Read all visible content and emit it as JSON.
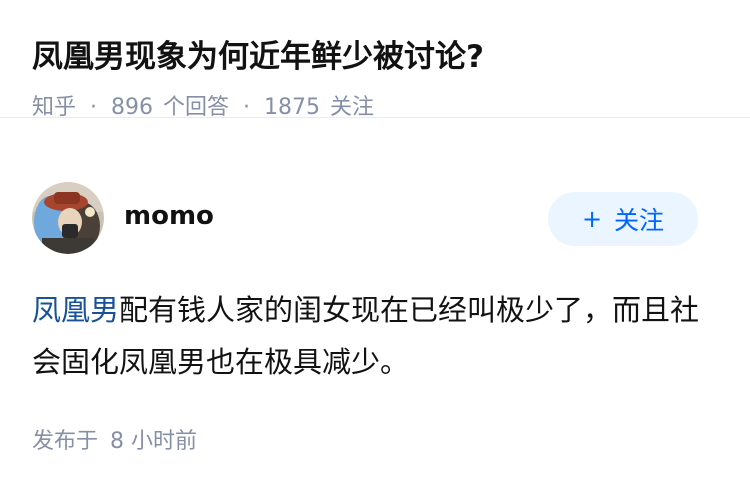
{
  "question": {
    "title": "凤凰男现象为何近年鲜少被讨论?",
    "source": "知乎",
    "answers_count": "896",
    "answers_label": "个回答",
    "followers_count": "1875",
    "followers_label": "关注",
    "separator": "·"
  },
  "answer": {
    "author": {
      "name": "momo",
      "avatar_icon": "avatar-photo-icon"
    },
    "follow_button": {
      "plus": "+",
      "label": "关注"
    },
    "content": {
      "keyword": "凤凰男",
      "text": "配有钱人家的闺女现在已经叫极少了，而且社会固化凤凰男也在极具减少。"
    },
    "time": {
      "prefix": "发布于",
      "value": "8 小时前"
    }
  },
  "colors": {
    "meta": "#8590a6",
    "link": "#175199",
    "brand": "#0066ff",
    "follow_bg": "#ebf5ff"
  }
}
